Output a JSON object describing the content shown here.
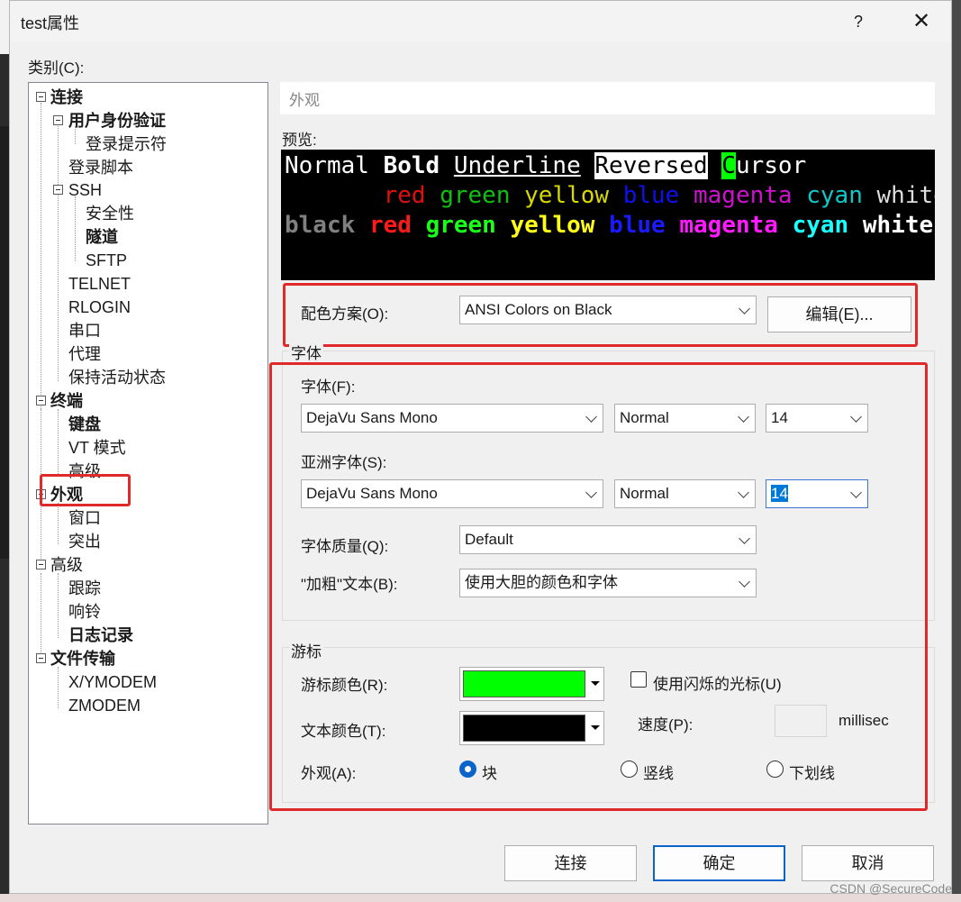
{
  "window": {
    "title": "test属性",
    "help": "?",
    "close": "✕"
  },
  "category_label": "类别(C):",
  "tree": [
    {
      "label": "连接",
      "bold": true
    },
    {
      "label": "用户身份验证",
      "bold": true
    },
    {
      "label": "登录提示符",
      "bold": false
    },
    {
      "label": "登录脚本",
      "bold": false
    },
    {
      "label": "SSH",
      "bold": false
    },
    {
      "label": "安全性",
      "bold": false
    },
    {
      "label": "隧道",
      "bold": true
    },
    {
      "label": "SFTP",
      "bold": false
    },
    {
      "label": "TELNET",
      "bold": false
    },
    {
      "label": "RLOGIN",
      "bold": false
    },
    {
      "label": "串口",
      "bold": false
    },
    {
      "label": "代理",
      "bold": false
    },
    {
      "label": "保持活动状态",
      "bold": false
    },
    {
      "label": "终端",
      "bold": true
    },
    {
      "label": "键盘",
      "bold": true
    },
    {
      "label": "VT 模式",
      "bold": false
    },
    {
      "label": "高级",
      "bold": false
    },
    {
      "label": "外观",
      "bold": true
    },
    {
      "label": "窗口",
      "bold": false
    },
    {
      "label": "突出",
      "bold": false
    },
    {
      "label": "高级",
      "bold": false
    },
    {
      "label": "跟踪",
      "bold": false
    },
    {
      "label": "响铃",
      "bold": false
    },
    {
      "label": "日志记录",
      "bold": true
    },
    {
      "label": "文件传输",
      "bold": true
    },
    {
      "label": "X/YMODEM",
      "bold": false
    },
    {
      "label": "ZMODEM",
      "bold": false
    }
  ],
  "section_title": "外观",
  "preview": {
    "label": "预览:",
    "line1": {
      "normal": "Normal ",
      "bold": "Bold",
      "underline": "Underline",
      "reversed": "Reversed",
      "cursor_char": "C",
      "cursor_rest": "ursor"
    },
    "colors": {
      "red": "red",
      "green": "green",
      "yellow": "yellow",
      "blue": "blue",
      "magenta": "magenta",
      "cyan": "cyan",
      "white": "white",
      "black": "black"
    }
  },
  "scheme": {
    "label": "配色方案(O):",
    "value": "ANSI Colors on Black",
    "edit_button": "编辑(E)..."
  },
  "font_group": {
    "title": "字体",
    "font_label": "字体(F):",
    "font_value": "DejaVu Sans Mono",
    "font_style": "Normal",
    "font_size": "14",
    "asian_label": "亚洲字体(S):",
    "asian_value": "DejaVu Sans Mono",
    "asian_style": "Normal",
    "asian_size": "14",
    "quality_label": "字体质量(Q):",
    "quality_value": "Default",
    "bold_label": "\"加粗\"文本(B):",
    "bold_value": "使用大胆的颜色和字体"
  },
  "cursor_group": {
    "title": "游标",
    "cursor_color_label": "游标颜色(R):",
    "cursor_color": "#00ff00",
    "text_color_label": "文本颜色(T):",
    "text_color": "#000000",
    "blink_label": "使用闪烁的光标(U)",
    "blink_checked": false,
    "speed_label": "速度(P):",
    "speed_unit": "millisec",
    "appearance_label": "外观(A):",
    "options": [
      "块",
      "竖线",
      "下划线"
    ],
    "selected": 0
  },
  "buttons": {
    "connect": "连接",
    "ok": "确定",
    "cancel": "取消"
  },
  "watermark": "CSDN @SecureCode"
}
